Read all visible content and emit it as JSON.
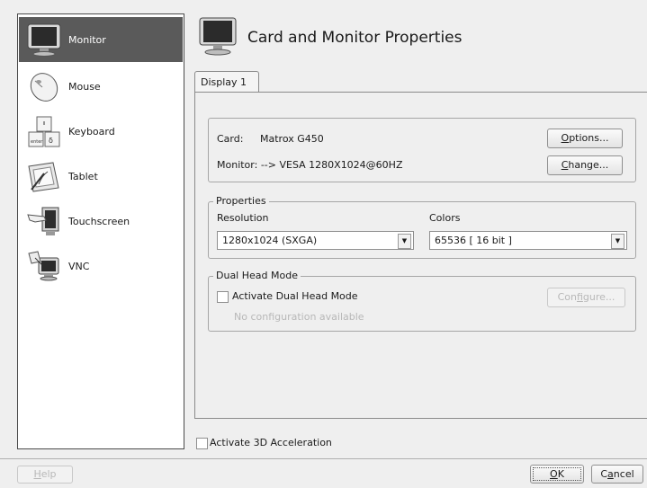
{
  "sidebar": {
    "items": [
      {
        "label": "Monitor",
        "icon": "monitor-icon"
      },
      {
        "label": "Mouse",
        "icon": "mouse-icon"
      },
      {
        "label": "Keyboard",
        "icon": "keyboard-icon"
      },
      {
        "label": "Tablet",
        "icon": "tablet-icon"
      },
      {
        "label": "Touchscreen",
        "icon": "touchscreen-icon"
      },
      {
        "label": "VNC",
        "icon": "vnc-icon"
      }
    ],
    "selected": "Monitor"
  },
  "header": {
    "title": "Card and Monitor Properties",
    "icon": "monitor-icon"
  },
  "tabs": [
    {
      "label": "Display 1"
    }
  ],
  "card": {
    "card_label": "Card:",
    "card_value": "Matrox G450",
    "monitor_text": "Monitor: --> VESA 1280X1024@60HZ",
    "options_button": {
      "pre": "",
      "key": "O",
      "post": "ptions..."
    },
    "change_button": {
      "pre": "",
      "key": "C",
      "post": "hange..."
    }
  },
  "properties": {
    "legend": "Properties",
    "resolution_label": "Resolution",
    "resolution_value": "1280x1024 (SXGA)",
    "colors_label": "Colors",
    "colors_value": "65536 [ 16 bit ]"
  },
  "dual_head": {
    "legend": "Dual Head Mode",
    "checkbox_label": "Activate Dual Head Mode",
    "checked": false,
    "info": "No configuration available",
    "configure_button": {
      "pre": "Con",
      "key": "f",
      "post": "igure..."
    }
  },
  "accel": {
    "checkbox_label": "Activate 3D Acceleration",
    "checked": false
  },
  "footer": {
    "help_button": {
      "pre": "",
      "key": "H",
      "post": "elp"
    },
    "ok_button": {
      "pre": "",
      "key": "O",
      "post": "K"
    },
    "cancel_button": {
      "pre": "C",
      "key": "a",
      "post": "ncel"
    }
  }
}
